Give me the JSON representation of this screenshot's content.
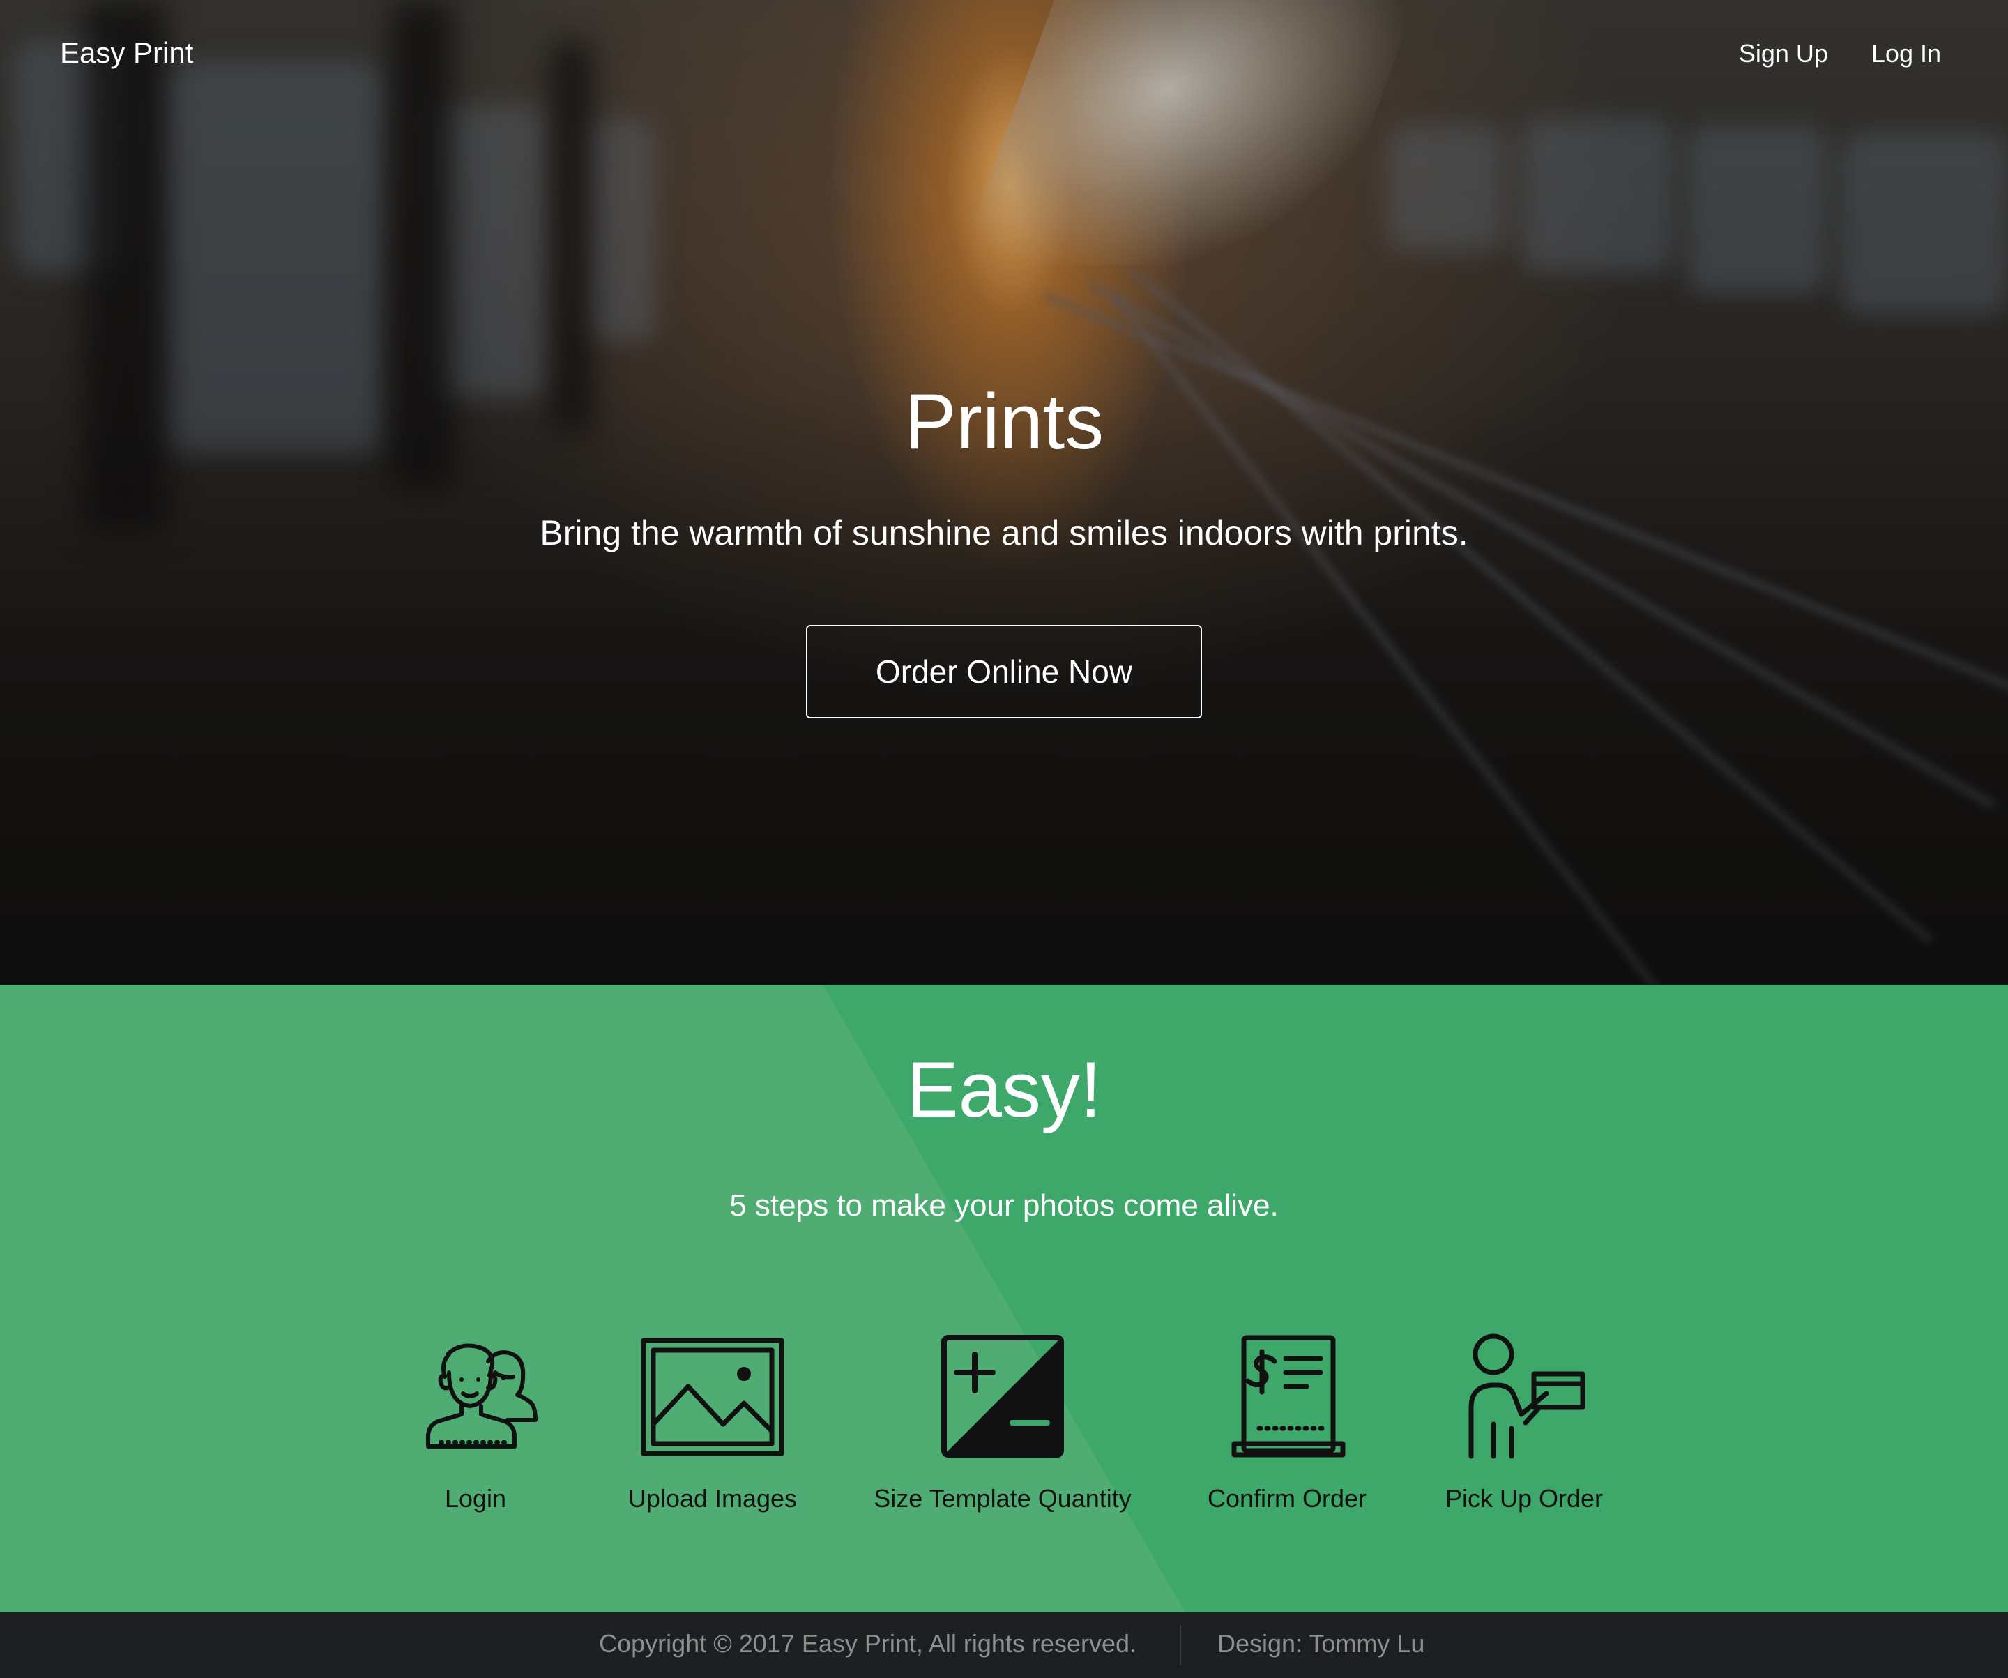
{
  "header": {
    "brand": "Easy Print",
    "nav": {
      "signup": "Sign Up",
      "login": "Log In"
    }
  },
  "hero": {
    "title": "Prints",
    "subtitle": "Bring the warmth of sunshine and smiles indoors with prints.",
    "cta_label": "Order Online Now"
  },
  "steps": {
    "title": "Easy!",
    "subtitle": "5 steps to make your photos come alive.",
    "items": [
      {
        "label": "Login",
        "icon": "users-icon"
      },
      {
        "label": "Upload Images",
        "icon": "image-frame-icon"
      },
      {
        "label": "Size Template Quantity",
        "icon": "plus-minus-icon"
      },
      {
        "label": "Confirm Order",
        "icon": "invoice-icon"
      },
      {
        "label": "Pick Up Order",
        "icon": "person-package-icon"
      }
    ]
  },
  "footer": {
    "copyright": "Copyright © 2017 Easy Print, All rights reserved.",
    "design": "Design: Tommy Lu"
  },
  "colors": {
    "green_primary": "#3da86a",
    "green_light": "#4fad73",
    "footer_bg": "#1e1f20",
    "footer_text": "#8d8f91"
  }
}
